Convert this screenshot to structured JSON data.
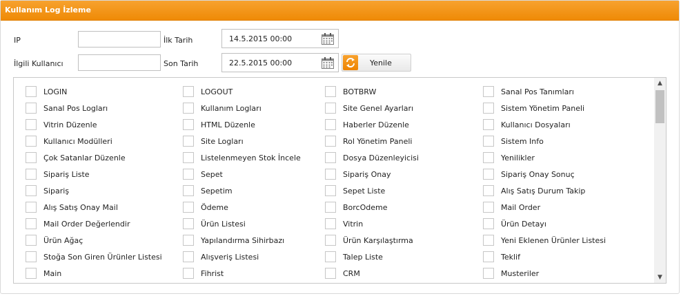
{
  "panel": {
    "title": "Kullanım Log İzleme"
  },
  "form": {
    "ip_label": "IP",
    "ip_value": "",
    "user_label": "İlgili Kullanıcı",
    "user_value": "",
    "start_label": "İlk Tarih",
    "start_value": "14.5.2015 00:00",
    "end_label": "Son Tarih",
    "end_value": "22.5.2015 00:00",
    "refresh_label": "Yenile",
    "calendar_icon": "calendar-icon",
    "refresh_icon": "refresh-icon"
  },
  "accent_color": "#f39212",
  "items": [
    "LOGIN",
    "LOGOUT",
    "BOTBRW",
    "Sanal Pos Tanımları",
    "Sanal Pos Logları",
    "Kullanım Logları",
    "Site Genel Ayarları",
    "Sistem Yönetim Paneli",
    "Vitrin Düzenle",
    "HTML Düzenle",
    "Haberler Düzenle",
    "Kullanıcı Dosyaları",
    "Kullanıcı Modülleri",
    "Site Logları",
    "Rol Yönetim Paneli",
    "Sistem Info",
    "Çok Satanlar Düzenle",
    "Listelenmeyen Stok İncele",
    "Dosya Düzenleyicisi",
    "Yenilikler",
    "Sipariş Liste",
    "Sepet",
    "Sipariş Onay",
    "Sipariş Onay Sonuç",
    "Sipariş",
    "Sepetim",
    "Sepet Liste",
    "Alış Satış Durum Takip",
    "Alış Satış Onay Mail",
    "Ödeme",
    "BorcOdeme",
    "Mail Order",
    "Mail Order Değerlendir",
    "Ürün Listesi",
    "Vitrin",
    "Ürün Detayı",
    "Ürün Ağaç",
    "Yapılandırma Sihirbazı",
    "Ürün Karşılaştırma",
    "Yeni Eklenen Ürünler Listesi",
    "Stoğa Son Giren Ürünler Listesi",
    "Alışveriş Listesi",
    "Talep Liste",
    "Teklif",
    "Main",
    "Fihrist",
    "CRM",
    "Musteriler"
  ]
}
